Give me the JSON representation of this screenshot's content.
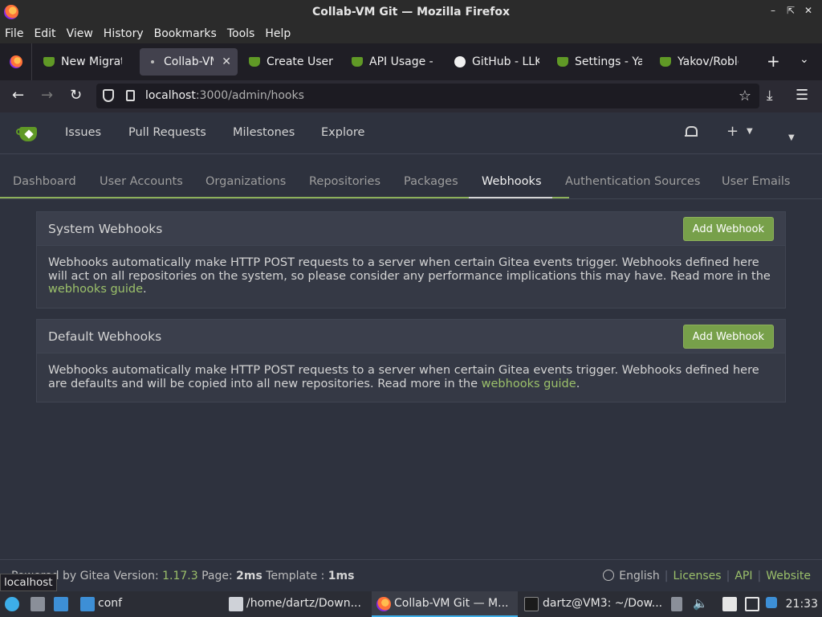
{
  "window": {
    "title": "Collab-VM Git — Mozilla Firefox"
  },
  "menu": [
    "File",
    "Edit",
    "View",
    "History",
    "Bookmarks",
    "Tools",
    "Help"
  ],
  "tabs": [
    {
      "label": "New Migratio",
      "icon": "gitea-icon"
    },
    {
      "label": "Collab-VM",
      "icon": "loading-dot-icon",
      "active": true
    },
    {
      "label": "Create User",
      "icon": "gitea-icon"
    },
    {
      "label": "API Usage - [",
      "icon": "gitea-icon"
    },
    {
      "label": "GitHub - LLK",
      "icon": "github-icon"
    },
    {
      "label": "Settings - Ya",
      "icon": "gitea-icon"
    },
    {
      "label": "Yakov/Roblox",
      "icon": "gitea-icon"
    }
  ],
  "urlbar": {
    "host": "localhost",
    "path": ":3000/admin/hooks"
  },
  "gitea_nav": [
    "Issues",
    "Pull Requests",
    "Milestones",
    "Explore"
  ],
  "admin_tabs": [
    "Dashboard",
    "User Accounts",
    "Organizations",
    "Repositories",
    "Packages",
    "Webhooks",
    "Authentication Sources",
    "User Emails"
  ],
  "system_webhooks": {
    "title": "System Webhooks",
    "button": "Add Webhook",
    "text": "Webhooks automatically make HTTP POST requests to a server when certain Gitea events trigger. Webhooks defined here will act on all repositories on the system, so please consider any performance implications this may have. Read more in the ",
    "link": "webhooks guide",
    "tail": "."
  },
  "default_webhooks": {
    "title": "Default Webhooks",
    "button": "Add Webhook",
    "text": "Webhooks automatically make HTTP POST requests to a server when certain Gitea events trigger. Webhooks defined here are defaults and will be copied into all new repositories. Read more in the ",
    "link": "webhooks guide",
    "tail": "."
  },
  "footer": {
    "powered": "Powered by Gitea Version: ",
    "version": "1.17.3",
    "page_label": " Page: ",
    "page_time": "2ms",
    "template_label": " Template : ",
    "template_time": "1ms",
    "language": "English",
    "licenses": "Licenses",
    "api": "API",
    "website": "Website"
  },
  "tooltip": "localhost",
  "taskbar": {
    "items": [
      {
        "label": "conf"
      },
      {
        "label": "/home/dartz/Down..."
      },
      {
        "label": "Collab-VM Git — M..."
      },
      {
        "label": "dartz@VM3: ~/Dow..."
      }
    ],
    "clock": "21:33"
  },
  "colors": {
    "accent": "#609926",
    "link": "#9bc06a",
    "button": "#77a04a"
  }
}
